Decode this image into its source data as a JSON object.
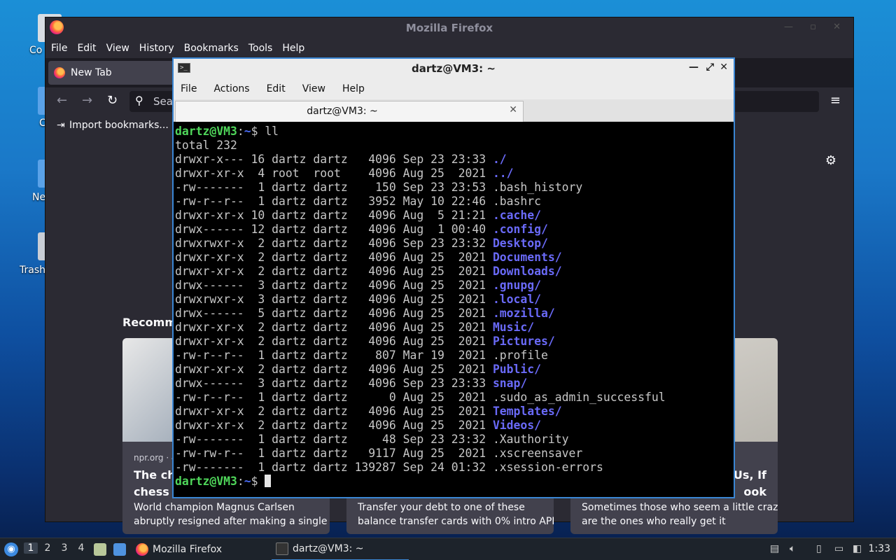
{
  "desktop": {
    "icons": [
      {
        "label": "Co"
      },
      {
        "label": "C"
      },
      {
        "label": "Ne"
      },
      {
        "label": "Trash"
      }
    ]
  },
  "firefox": {
    "window_title": "Mozilla Firefox",
    "menu": [
      "File",
      "Edit",
      "View",
      "History",
      "Bookmarks",
      "Tools",
      "Help"
    ],
    "tab_label": "New Tab",
    "url_placeholder": "Sea",
    "bookmark_label": "Import bookmarks...",
    "recommended_heading": "Recomme",
    "cards": [
      {
        "source": "npr.org · 4",
        "title": "The ch\nchess w",
        "desc": "World champion Magnus Carlsen\nabruptly resigned after making a single"
      },
      {
        "source": "",
        "title": "",
        "desc": "Transfer your debt to one of these\nbalance transfer cards with 0% intro APR"
      },
      {
        "source": "",
        "title": "Us, If\nook",
        "desc": "Sometimes those who seem a little crazy\nare the ones who really get it"
      }
    ]
  },
  "terminal": {
    "window_title": "dartz@VM3: ~",
    "menu": [
      "File",
      "Actions",
      "Edit",
      "View",
      "Help"
    ],
    "tab_label": "dartz@VM3: ~",
    "prompt_user": "dartz@VM3",
    "prompt_sep": ":",
    "prompt_path": "~",
    "prompt_end": "$ ",
    "command": "ll",
    "total_line": "total 232",
    "entries": [
      {
        "meta": "drwxr-x--- 16 dartz dartz   4096 Sep 23 23:33 ",
        "name": "./",
        "type": "dir"
      },
      {
        "meta": "drwxr-xr-x  4 root  root    4096 Aug 25  2021 ",
        "name": "../",
        "type": "dir"
      },
      {
        "meta": "-rw-------  1 dartz dartz    150 Sep 23 23:53 ",
        "name": ".bash_history",
        "type": "file"
      },
      {
        "meta": "-rw-r--r--  1 dartz dartz   3952 May 10 22:46 ",
        "name": ".bashrc",
        "type": "file"
      },
      {
        "meta": "drwxr-xr-x 10 dartz dartz   4096 Aug  5 21:21 ",
        "name": ".cache/",
        "type": "dir"
      },
      {
        "meta": "drwx------ 12 dartz dartz   4096 Aug  1 00:40 ",
        "name": ".config/",
        "type": "dir"
      },
      {
        "meta": "drwxrwxr-x  2 dartz dartz   4096 Sep 23 23:32 ",
        "name": "Desktop/",
        "type": "dir"
      },
      {
        "meta": "drwxr-xr-x  2 dartz dartz   4096 Aug 25  2021 ",
        "name": "Documents/",
        "type": "dir"
      },
      {
        "meta": "drwxr-xr-x  2 dartz dartz   4096 Aug 25  2021 ",
        "name": "Downloads/",
        "type": "dir"
      },
      {
        "meta": "drwx------  3 dartz dartz   4096 Aug 25  2021 ",
        "name": ".gnupg/",
        "type": "dir"
      },
      {
        "meta": "drwxrwxr-x  3 dartz dartz   4096 Aug 25  2021 ",
        "name": ".local/",
        "type": "dir"
      },
      {
        "meta": "drwx------  5 dartz dartz   4096 Aug 25  2021 ",
        "name": ".mozilla/",
        "type": "dir"
      },
      {
        "meta": "drwxr-xr-x  2 dartz dartz   4096 Aug 25  2021 ",
        "name": "Music/",
        "type": "dir"
      },
      {
        "meta": "drwxr-xr-x  2 dartz dartz   4096 Aug 25  2021 ",
        "name": "Pictures/",
        "type": "dir"
      },
      {
        "meta": "-rw-r--r--  1 dartz dartz    807 Mar 19  2021 ",
        "name": ".profile",
        "type": "file"
      },
      {
        "meta": "drwxr-xr-x  2 dartz dartz   4096 Aug 25  2021 ",
        "name": "Public/",
        "type": "dir"
      },
      {
        "meta": "drwx------  3 dartz dartz   4096 Sep 23 23:33 ",
        "name": "snap/",
        "type": "dir"
      },
      {
        "meta": "-rw-r--r--  1 dartz dartz      0 Aug 25  2021 ",
        "name": ".sudo_as_admin_successful",
        "type": "file"
      },
      {
        "meta": "drwxr-xr-x  2 dartz dartz   4096 Aug 25  2021 ",
        "name": "Templates/",
        "type": "dir"
      },
      {
        "meta": "drwxr-xr-x  2 dartz dartz   4096 Aug 25  2021 ",
        "name": "Videos/",
        "type": "dir"
      },
      {
        "meta": "-rw-------  1 dartz dartz     48 Sep 23 23:32 ",
        "name": ".Xauthority",
        "type": "file"
      },
      {
        "meta": "-rw-rw-r--  1 dartz dartz   9117 Aug 25  2021 ",
        "name": ".xscreensaver",
        "type": "file"
      },
      {
        "meta": "-rw-------  1 dartz dartz 139287 Sep 24 01:32 ",
        "name": ".xsession-errors",
        "type": "file"
      }
    ]
  },
  "taskbar": {
    "workspaces": [
      "1",
      "2",
      "3",
      "4"
    ],
    "tasks": [
      {
        "label": "Mozilla Firefox"
      },
      {
        "label": "dartz@VM3: ~"
      }
    ],
    "clock": "1:33"
  },
  "colors": {
    "prompt_user": "#4fd65a",
    "prompt_path": "#4a6cf7",
    "dir_name": "#6a6af8",
    "terminal_bg": "#000000",
    "firefox_bg": "#2b2a33"
  }
}
